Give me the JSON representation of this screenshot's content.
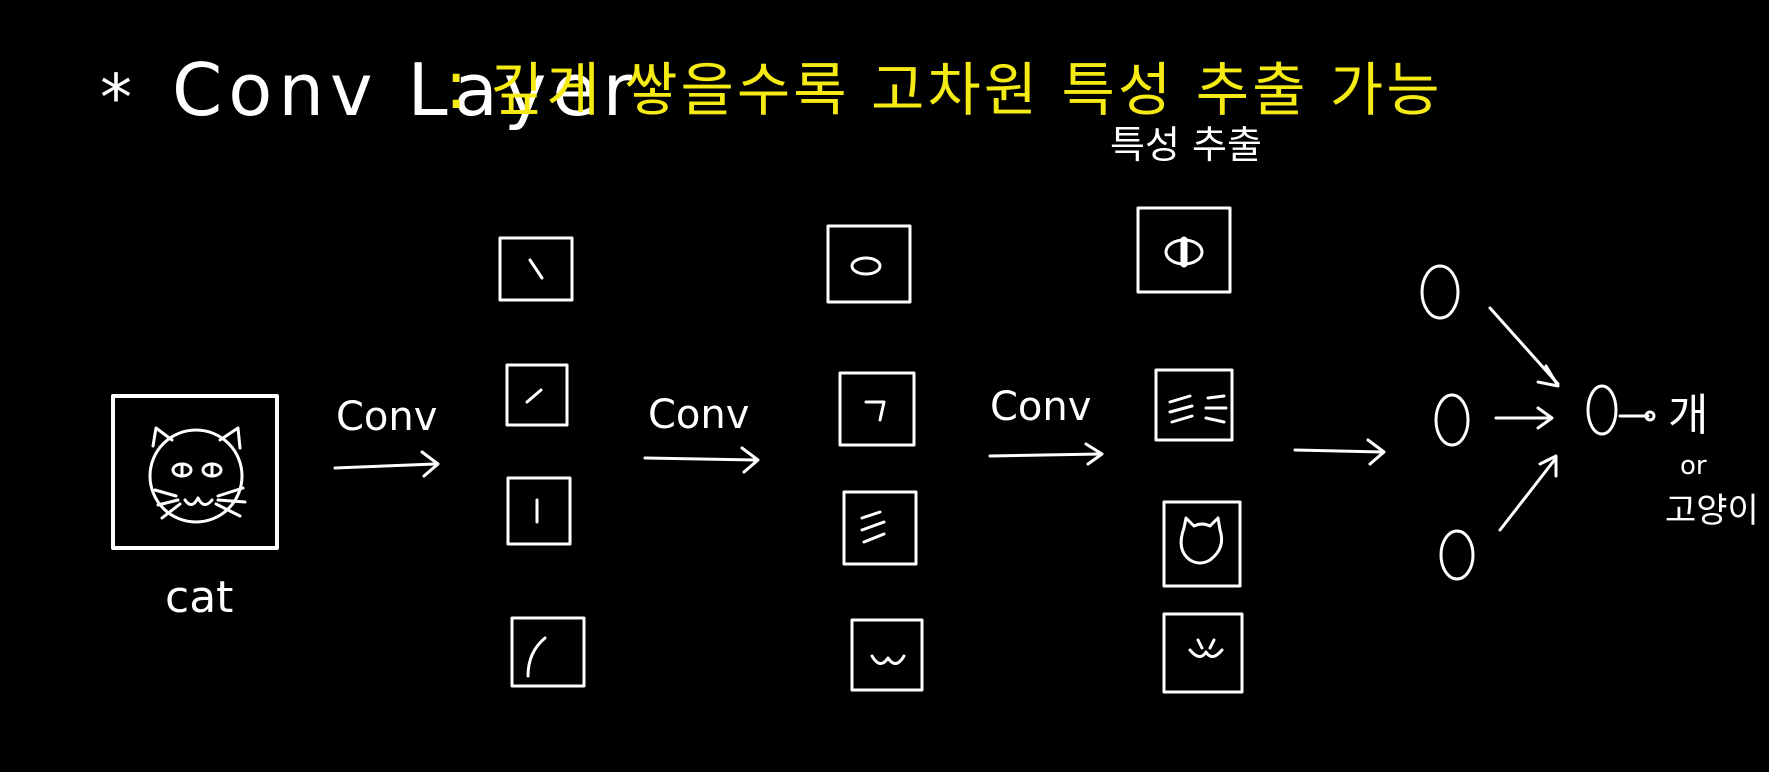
{
  "colors": {
    "background": "#000000",
    "ink": "#ffffff",
    "highlight": "#f5ea14"
  },
  "title": {
    "bullet": "*",
    "term": "Conv Layer",
    "colon": ":",
    "description": "깊게 쌓을수록 고차원 특성 추출 가능"
  },
  "annotation": "특성 추출",
  "input": {
    "label": "cat"
  },
  "arrows": {
    "conv_1": "Conv",
    "conv_2": "Conv",
    "conv_3": "Conv"
  },
  "stages": {
    "stage_1_features": [
      "diagonal-line",
      "slash-line",
      "vertical-line",
      "curve-line"
    ],
    "stage_2_features": [
      "ellipse-shape",
      "corner-shape",
      "parallel-lines",
      "wave-shape"
    ],
    "stage_3_features": [
      "eye-part",
      "whiskers-part",
      "cat-head-part",
      "mouth-part"
    ]
  },
  "output": {
    "class_1": "개",
    "or": "or",
    "class_2": "고양이"
  }
}
